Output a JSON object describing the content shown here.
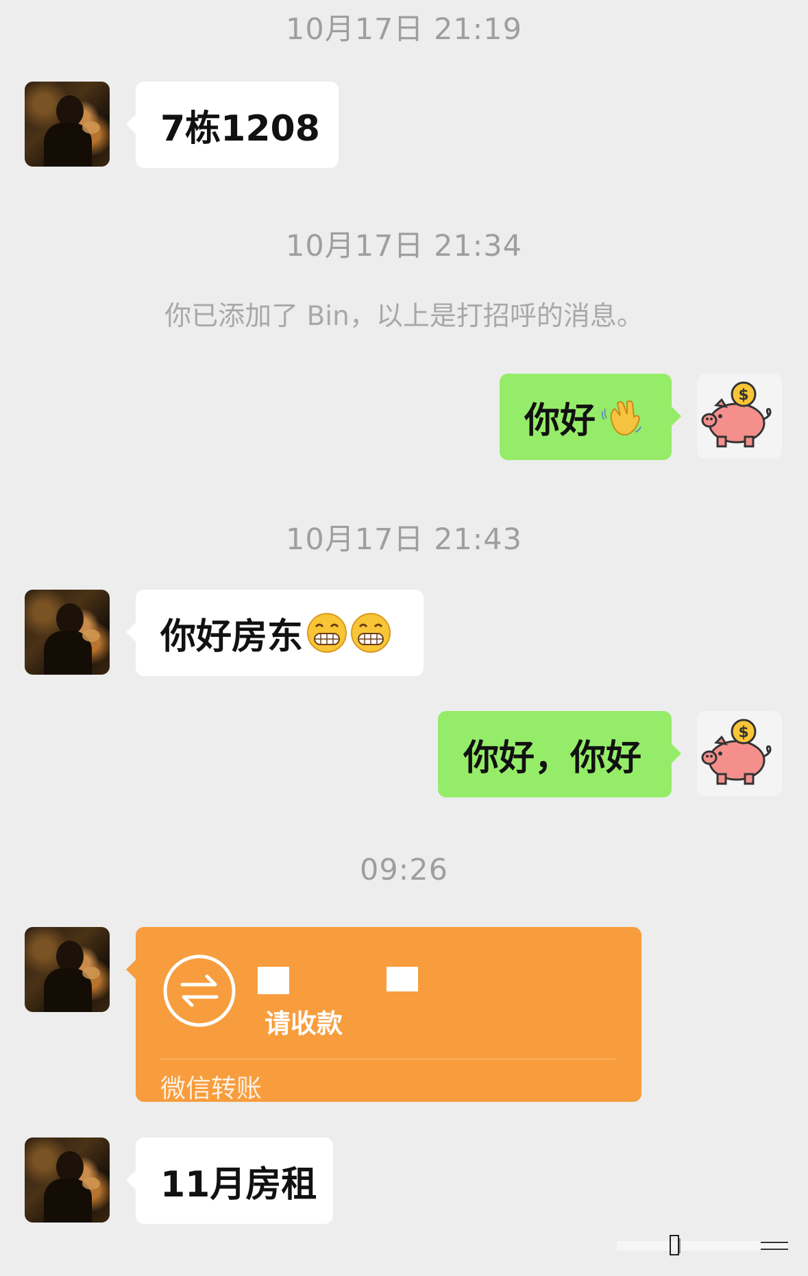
{
  "timestamps": [
    "10月17日 21:19",
    "10月17日 21:34",
    "10月17日 21:43",
    "09:26"
  ],
  "system_notice": "你已添加了 Bin，以上是打招呼的消息。",
  "messages": {
    "m1": "7栋1208",
    "m2": "你好",
    "m3": "你好房东",
    "m4": "你好，你好",
    "m6": "11月房租"
  },
  "transfer": {
    "label": "请收款",
    "footer": "微信转账",
    "color": "#f79d3d"
  },
  "colors": {
    "background": "#ededed",
    "outgoing_bubble": "#95ec69",
    "incoming_bubble": "#ffffff",
    "timestamp_text": "#9e9e9e"
  },
  "icons": {
    "incoming_avatar": "person-photo-avatar",
    "outgoing_avatar": "piggy-bank-avatar",
    "wave_emoji": "waving-hand-icon",
    "grin_emoji": "grinning-face-icon",
    "transfer_icon": "transfer-arrows-icon"
  }
}
